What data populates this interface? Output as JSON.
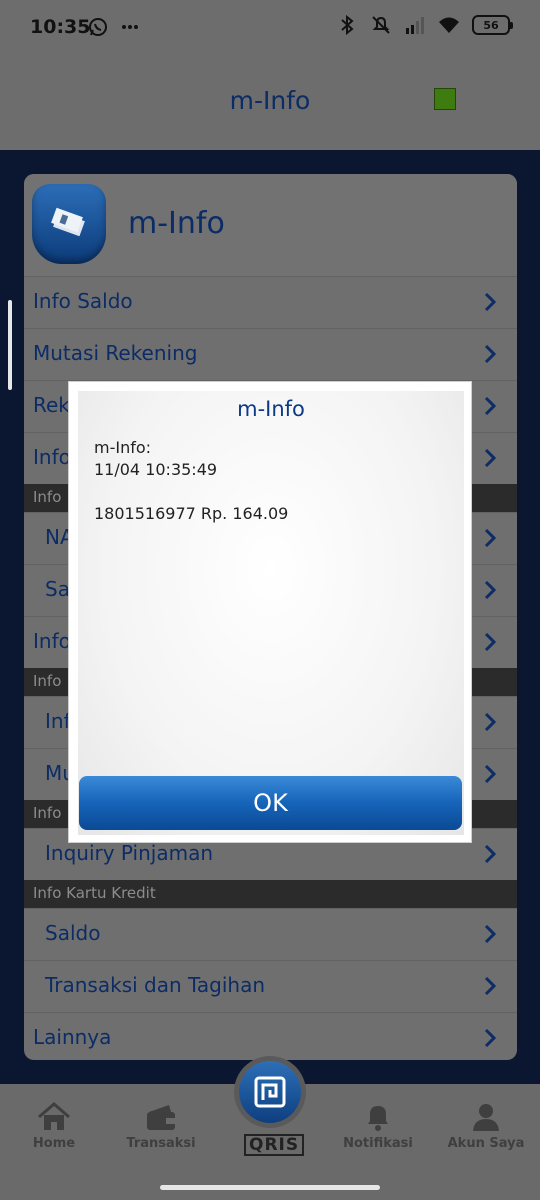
{
  "status_bar": {
    "time": "10:35",
    "left_icons": [
      "whatsapp-icon",
      "more-dots-icon"
    ],
    "right_icons": [
      "bluetooth-icon",
      "mute-icon",
      "signal-icon",
      "wifi-icon"
    ],
    "battery": "56"
  },
  "header": {
    "title": "m-Info",
    "indicator_color": "#3f7c0f"
  },
  "card": {
    "title": "m-Info",
    "items": [
      {
        "type": "item",
        "label": "Info Saldo"
      },
      {
        "type": "item",
        "label": "Mutasi Rekening"
      },
      {
        "type": "item",
        "label": "Rek"
      },
      {
        "type": "item",
        "label": "Info"
      },
      {
        "type": "section",
        "label": "Info"
      },
      {
        "type": "sub",
        "label": "NA"
      },
      {
        "type": "sub",
        "label": "Sa"
      },
      {
        "type": "item",
        "label": "Info"
      },
      {
        "type": "section",
        "label": "Info"
      },
      {
        "type": "sub",
        "label": "Inf"
      },
      {
        "type": "sub",
        "label": "Mu"
      },
      {
        "type": "section",
        "label": "Info"
      },
      {
        "type": "sub",
        "label": "Inquiry Pinjaman"
      },
      {
        "type": "section",
        "label": "Info Kartu Kredit"
      },
      {
        "type": "sub",
        "label": "Saldo"
      },
      {
        "type": "sub",
        "label": "Transaksi dan Tagihan"
      },
      {
        "type": "item",
        "label": "Lainnya"
      }
    ]
  },
  "dialog": {
    "title": "m-Info",
    "message": "m-Info:\n11/04 10:35:49\n\n1801516977 Rp. 164.09",
    "ok_label": "OK"
  },
  "bottom_nav": {
    "items": [
      {
        "label": "Home",
        "icon": "home-icon"
      },
      {
        "label": "Transaksi",
        "icon": "wallet-icon"
      },
      {
        "label": "Notifikasi",
        "icon": "bell-icon"
      },
      {
        "label": "Akun Saya",
        "icon": "user-icon"
      }
    ],
    "qris_label": "QRIS"
  },
  "colors": {
    "accent": "#0c2c66",
    "button": "#1664b9",
    "section_bg": "#2b2b2b"
  }
}
